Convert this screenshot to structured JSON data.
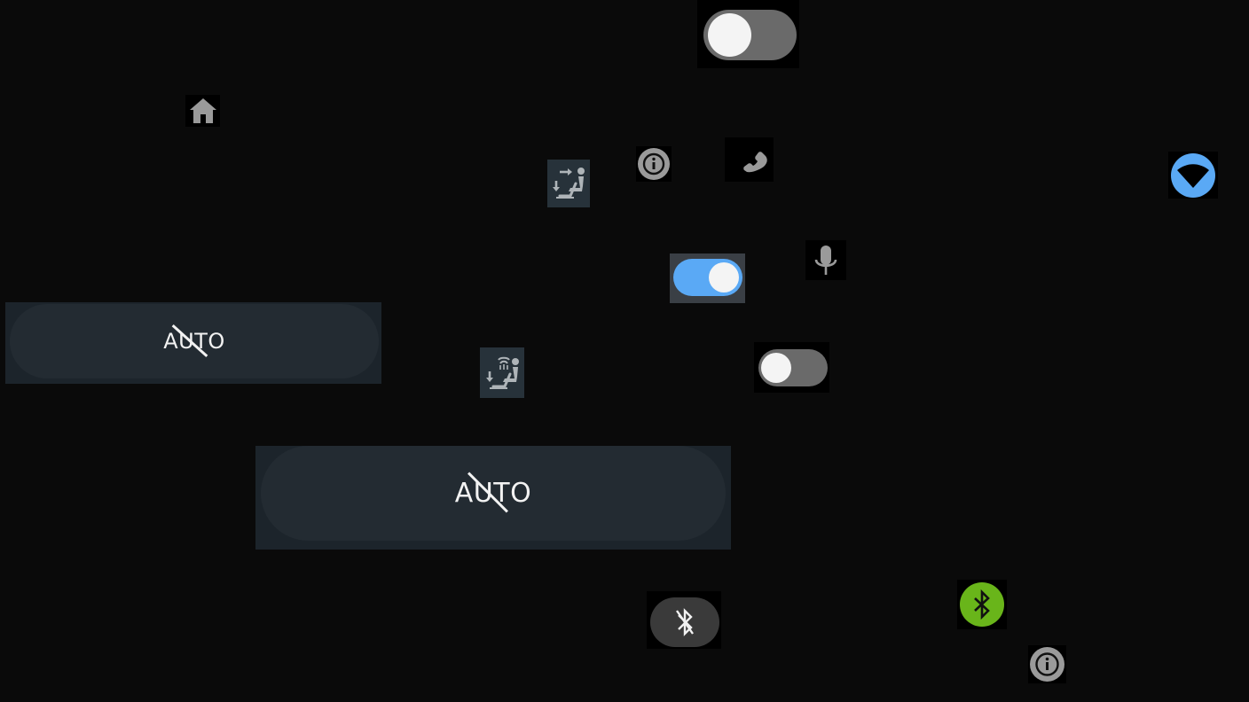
{
  "colors": {
    "background": "#0a0a0a",
    "toggle_on_track": "#5aa9f5",
    "toggle_off_track": "#6a6a6a",
    "knob": "#f4f4f4",
    "icon_gray": "#9a9a9a",
    "bluetooth_active": "#69b51a",
    "wifi_blue": "#5aa9f5",
    "auto_panel": "#1c242b",
    "auto_pill": "#232b32"
  },
  "toggles": [
    {
      "id": "toggle-top",
      "state": "off"
    },
    {
      "id": "toggle-mid",
      "state": "on"
    },
    {
      "id": "toggle-lower",
      "state": "off"
    }
  ],
  "auto_buttons": [
    {
      "id": "auto-left",
      "label": "AUTO",
      "state": "disabled"
    },
    {
      "id": "auto-center",
      "label": "AUTO",
      "state": "disabled"
    }
  ],
  "icons": [
    "home-icon",
    "seat-airflow-icon",
    "seat-heat-icon",
    "info-icon",
    "phone-icon",
    "microphone-icon",
    "wifi-icon",
    "bluetooth-off-icon",
    "bluetooth-on-icon"
  ]
}
